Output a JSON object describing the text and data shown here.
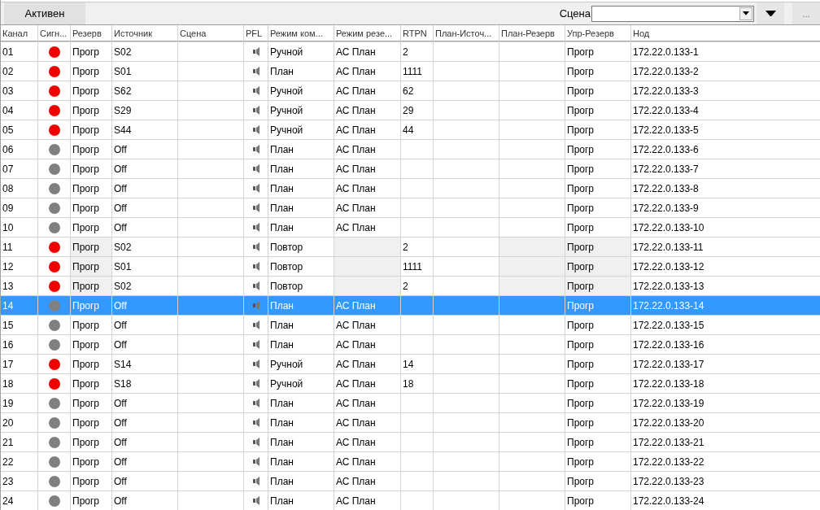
{
  "toolbar": {
    "status_button": "Активен",
    "scene_label": "Сцена",
    "more_button": "..."
  },
  "table": {
    "columns": [
      "Канал",
      "Сигн...",
      "Резерв",
      "Источник",
      "Сцена",
      "PFL",
      "Режим ком...",
      "Режим резе...",
      "RTPN",
      "План-Источ...",
      "План-Резерв",
      "Упр-Резерв",
      "Нод"
    ],
    "rows": [
      {
        "channel": "01",
        "signal_on": true,
        "reserve": "Прогр",
        "source": "S02",
        "mode": "Ручной",
        "reserve_mode": "АС План",
        "rtpn": "2",
        "ctrl_reserve": "Прогр",
        "node": "172.22.0.133-1",
        "locked": false,
        "selected": false
      },
      {
        "channel": "02",
        "signal_on": true,
        "reserve": "Прогр",
        "source": "S01",
        "mode": "План",
        "reserve_mode": "АС План",
        "rtpn": "1111",
        "ctrl_reserve": "Прогр",
        "node": "172.22.0.133-2",
        "locked": false,
        "selected": false
      },
      {
        "channel": "03",
        "signal_on": true,
        "reserve": "Прогр",
        "source": "S62",
        "mode": "Ручной",
        "reserve_mode": "АС План",
        "rtpn": "62",
        "ctrl_reserve": "Прогр",
        "node": "172.22.0.133-3",
        "locked": false,
        "selected": false
      },
      {
        "channel": "04",
        "signal_on": true,
        "reserve": "Прогр",
        "source": "S29",
        "mode": "Ручной",
        "reserve_mode": "АС План",
        "rtpn": "29",
        "ctrl_reserve": "Прогр",
        "node": "172.22.0.133-4",
        "locked": false,
        "selected": false
      },
      {
        "channel": "05",
        "signal_on": true,
        "reserve": "Прогр",
        "source": "S44",
        "mode": "Ручной",
        "reserve_mode": "АС План",
        "rtpn": "44",
        "ctrl_reserve": "Прогр",
        "node": "172.22.0.133-5",
        "locked": false,
        "selected": false
      },
      {
        "channel": "06",
        "signal_on": false,
        "reserve": "Прогр",
        "source": "Off",
        "mode": "План",
        "reserve_mode": "АС План",
        "ctrl_reserve": "Прогр",
        "node": "172.22.0.133-6",
        "locked": false,
        "selected": false
      },
      {
        "channel": "07",
        "signal_on": false,
        "reserve": "Прогр",
        "source": "Off",
        "mode": "План",
        "reserve_mode": "АС План",
        "ctrl_reserve": "Прогр",
        "node": "172.22.0.133-7",
        "locked": false,
        "selected": false
      },
      {
        "channel": "08",
        "signal_on": false,
        "reserve": "Прогр",
        "source": "Off",
        "mode": "План",
        "reserve_mode": "АС План",
        "ctrl_reserve": "Прогр",
        "node": "172.22.0.133-8",
        "locked": false,
        "selected": false
      },
      {
        "channel": "09",
        "signal_on": false,
        "reserve": "Прогр",
        "source": "Off",
        "mode": "План",
        "reserve_mode": "АС План",
        "ctrl_reserve": "Прогр",
        "node": "172.22.0.133-9",
        "locked": false,
        "selected": false
      },
      {
        "channel": "10",
        "signal_on": false,
        "reserve": "Прогр",
        "source": "Off",
        "mode": "План",
        "reserve_mode": "АС План",
        "ctrl_reserve": "Прогр",
        "node": "172.22.0.133-10",
        "locked": false,
        "selected": false
      },
      {
        "channel": "11",
        "signal_on": true,
        "reserve": "Прогр",
        "source": "S02",
        "mode": "Повтор",
        "rtpn": "2",
        "ctrl_reserve": "Прогр",
        "node": "172.22.0.133-11",
        "locked": true,
        "selected": false
      },
      {
        "channel": "12",
        "signal_on": true,
        "reserve": "Прогр",
        "source": "S01",
        "mode": "Повтор",
        "rtpn": "1111",
        "ctrl_reserve": "Прогр",
        "node": "172.22.0.133-12",
        "locked": true,
        "selected": false
      },
      {
        "channel": "13",
        "signal_on": true,
        "reserve": "Прогр",
        "source": "S02",
        "mode": "Повтор",
        "rtpn": "2",
        "ctrl_reserve": "Прогр",
        "node": "172.22.0.133-13",
        "locked": true,
        "selected": false
      },
      {
        "channel": "14",
        "signal_on": false,
        "reserve": "Прогр",
        "source": "Off",
        "mode": "План",
        "reserve_mode": "АС План",
        "ctrl_reserve": "Прогр",
        "node": "172.22.0.133-14",
        "locked": false,
        "selected": true
      },
      {
        "channel": "15",
        "signal_on": false,
        "reserve": "Прогр",
        "source": "Off",
        "mode": "План",
        "reserve_mode": "АС План",
        "ctrl_reserve": "Прогр",
        "node": "172.22.0.133-15",
        "locked": false,
        "selected": false
      },
      {
        "channel": "16",
        "signal_on": false,
        "reserve": "Прогр",
        "source": "Off",
        "mode": "План",
        "reserve_mode": "АС План",
        "ctrl_reserve": "Прогр",
        "node": "172.22.0.133-16",
        "locked": false,
        "selected": false
      },
      {
        "channel": "17",
        "signal_on": true,
        "reserve": "Прогр",
        "source": "S14",
        "mode": "Ручной",
        "reserve_mode": "АС План",
        "rtpn": "14",
        "ctrl_reserve": "Прогр",
        "node": "172.22.0.133-17",
        "locked": false,
        "selected": false
      },
      {
        "channel": "18",
        "signal_on": true,
        "reserve": "Прогр",
        "source": "S18",
        "mode": "Ручной",
        "reserve_mode": "АС План",
        "rtpn": "18",
        "ctrl_reserve": "Прогр",
        "node": "172.22.0.133-18",
        "locked": false,
        "selected": false
      },
      {
        "channel": "19",
        "signal_on": false,
        "reserve": "Прогр",
        "source": "Off",
        "mode": "План",
        "reserve_mode": "АС План",
        "ctrl_reserve": "Прогр",
        "node": "172.22.0.133-19",
        "locked": false,
        "selected": false
      },
      {
        "channel": "20",
        "signal_on": false,
        "reserve": "Прогр",
        "source": "Off",
        "mode": "План",
        "reserve_mode": "АС План",
        "ctrl_reserve": "Прогр",
        "node": "172.22.0.133-20",
        "locked": false,
        "selected": false
      },
      {
        "channel": "21",
        "signal_on": false,
        "reserve": "Прогр",
        "source": "Off",
        "mode": "План",
        "reserve_mode": "АС План",
        "ctrl_reserve": "Прогр",
        "node": "172.22.0.133-21",
        "locked": false,
        "selected": false
      },
      {
        "channel": "22",
        "signal_on": false,
        "reserve": "Прогр",
        "source": "Off",
        "mode": "План",
        "reserve_mode": "АС План",
        "ctrl_reserve": "Прогр",
        "node": "172.22.0.133-22",
        "locked": false,
        "selected": false
      },
      {
        "channel": "23",
        "signal_on": false,
        "reserve": "Прогр",
        "source": "Off",
        "mode": "План",
        "reserve_mode": "АС План",
        "ctrl_reserve": "Прогр",
        "node": "172.22.0.133-23",
        "locked": false,
        "selected": false
      },
      {
        "channel": "24",
        "signal_on": false,
        "reserve": "Прогр",
        "source": "Off",
        "mode": "План",
        "reserve_mode": "АС План",
        "ctrl_reserve": "Прогр",
        "node": "172.22.0.133-24",
        "locked": false,
        "selected": false
      }
    ]
  }
}
